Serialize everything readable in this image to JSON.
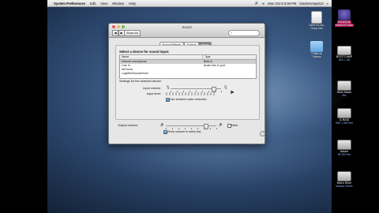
{
  "menubar": {
    "apple": "",
    "items": [
      "System Preferences",
      "Edit",
      "View",
      "Window",
      "Help"
    ],
    "clock": "Mon Oct 8 9:39 PM",
    "user": "bradnesmap013"
  },
  "desktop_icons": [
    {
      "label": "Oxford iLink-",
      "sub": "Drmp elia"
    },
    {
      "label": "Macintosh",
      "sub": "KabitiOS Mac"
    },
    {
      "label": "Fullerral",
      "sub": "Videos"
    },
    {
      "label": "BOOTCAMP",
      "sub": "SES 1 GB"
    },
    {
      "label": "ffmm Marm",
      "sub": "Mic"
    },
    {
      "label": "G-RAID",
      "sub": "SSE 1 GB Free"
    },
    {
      "label": "Adobe",
      "sub": "99 GB Free"
    },
    {
      "label": "Micro Drive",
      "sub": "backup 3 trees"
    }
  ],
  "window": {
    "title": "Sound",
    "show_all": "Show All",
    "nav_back": "◀",
    "nav_forward": "▶",
    "search_icon": "magnifier-icon",
    "tabs": [
      {
        "label": "Sound Effects",
        "active": false
      },
      {
        "label": "Output",
        "active": false
      },
      {
        "label": "Input",
        "active": true
      }
    ],
    "select_heading": "Select a device for sound input:",
    "table": {
      "headers": [
        "Name",
        "Type"
      ],
      "rows": [
        {
          "name": "Internal microphone",
          "type": "Built-in",
          "selected": true
        },
        {
          "name": "Line In",
          "type": "Audio line-in port",
          "selected": false
        },
        {
          "name": "AirParrot",
          "type": "",
          "selected": false
        },
        {
          "name": "LogMeInSoundDriver",
          "type": "",
          "selected": false
        }
      ]
    },
    "settings_heading": "Settings for the selected device:",
    "input_volume_label": "Input volume:",
    "input_volume_value": 0.85,
    "input_level_label": "Input level:",
    "input_level_value": 0,
    "noise_reduction_label": "Use ambient noise reduction",
    "noise_reduction_checked": true,
    "output_volume_label": "Output volume:",
    "output_volume_value": 0.78,
    "mute_label": "Mute",
    "mute_checked": false,
    "menu_bar_label": "Show volume in menu bar",
    "menu_bar_checked": true,
    "help": "?"
  }
}
